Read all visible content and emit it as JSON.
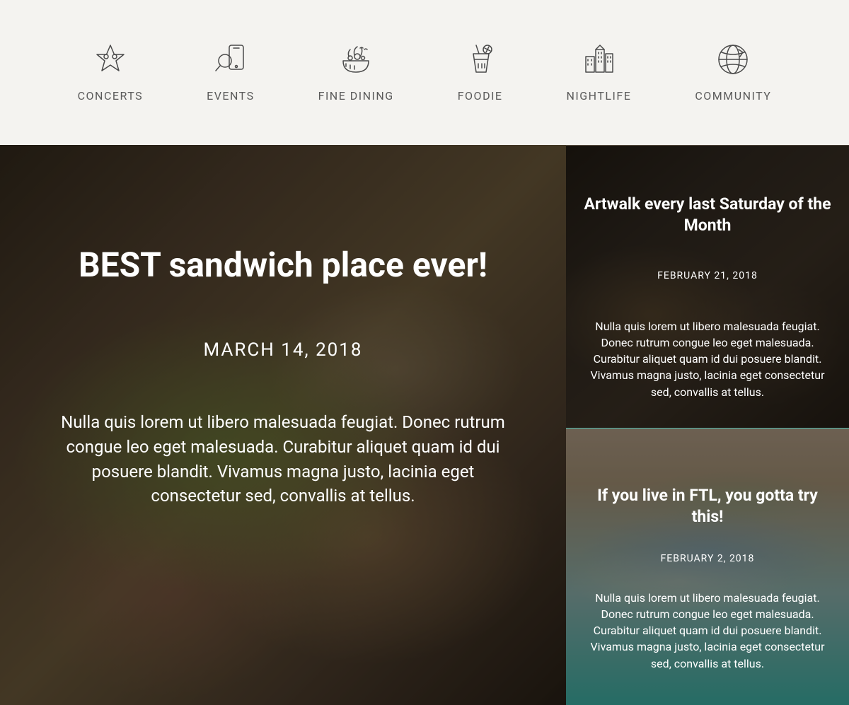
{
  "nav": {
    "items": [
      {
        "label": "CONCERTS",
        "icon": "star-icon"
      },
      {
        "label": "EVENTS",
        "icon": "search-phone-icon"
      },
      {
        "label": "FINE DINING",
        "icon": "salad-bowl-icon"
      },
      {
        "label": "FOODIE",
        "icon": "drink-icon"
      },
      {
        "label": "NIGHTLIFE",
        "icon": "city-icon"
      },
      {
        "label": "COMMUNITY",
        "icon": "globe-icon"
      }
    ]
  },
  "main_feature": {
    "title": "BEST sandwich place ever!",
    "date": "MARCH 14, 2018",
    "body": "Nulla quis lorem ut libero malesuada feugiat. Donec rutrum congue leo eget malesuada. Curabitur aliquet quam id dui posuere blandit. Vivamus magna justo, lacinia eget consectetur sed, convallis at tellus."
  },
  "side_cards": [
    {
      "title": "Artwalk every last Saturday of the Month",
      "date": "FEBRUARY  21, 2018",
      "body": "Nulla quis lorem ut libero malesuada feugiat. Donec rutrum congue leo eget malesuada. Curabitur aliquet quam id dui posuere blandit. Vivamus magna justo, lacinia eget consectetur sed, convallis at tellus."
    },
    {
      "title": "If you live in FTL, you gotta try this!",
      "date": "FEBRUARY 2, 2018",
      "body": "Nulla quis lorem ut libero malesuada feugiat. Donec rutrum congue leo eget malesuada. Curabitur aliquet quam id dui posuere blandit. Vivamus magna justo, lacinia eget consectetur sed, convallis at tellus."
    }
  ]
}
